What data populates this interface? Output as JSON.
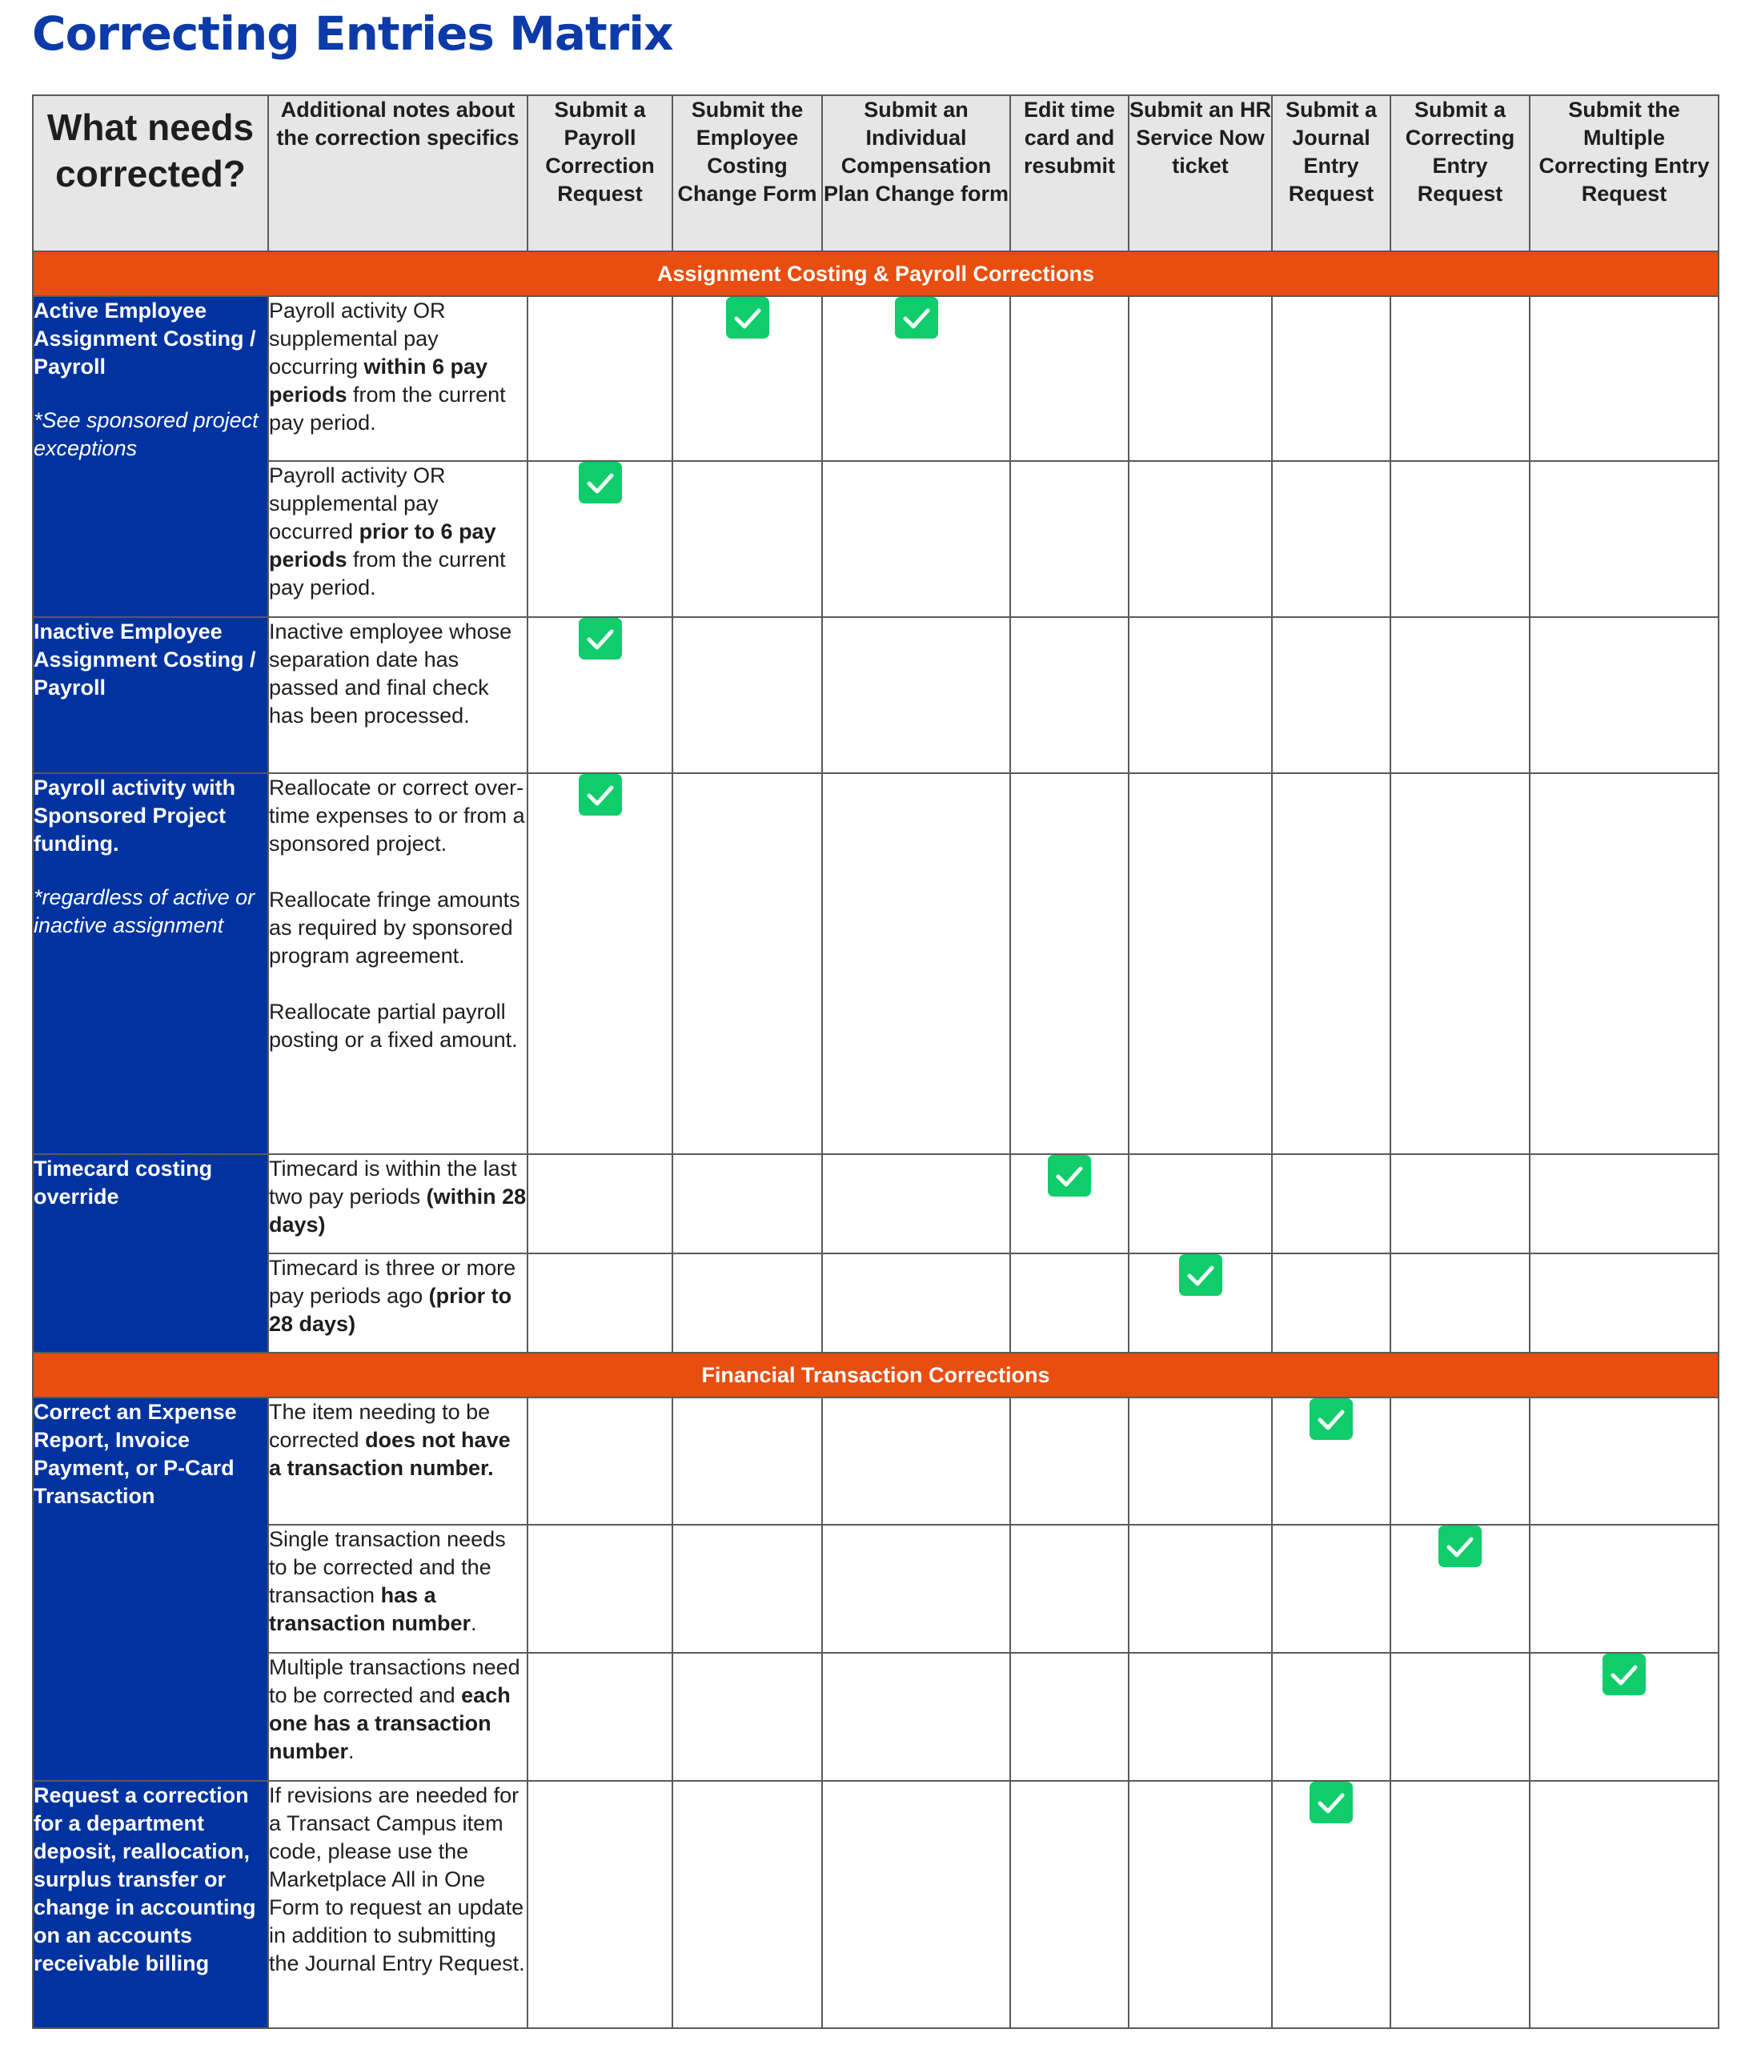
{
  "title": "Correcting Entries Matrix",
  "colors": {
    "title": "#0c3aa8",
    "header_bg": "#e6e6e6",
    "band_bg": "#e84e0f",
    "category_bg": "#0033a0",
    "check_bg": "#10cc6a"
  },
  "header": {
    "question": "What needs corrected?",
    "notes": "Additional notes about the correction specifics",
    "actions": [
      "Submit a Payroll Correction Request",
      "Submit the Employee Costing Change Form",
      "Submit an Individual Compensation Plan Change form",
      "Edit time card and resubmit",
      "Submit an HR Service Now ticket",
      "Submit a Journal Entry Request",
      "Submit a Correcting Entry Request",
      "Submit the Multiple Correcting Entry Request"
    ]
  },
  "sections": [
    {
      "label": "Assignment Costing & Payroll Corrections",
      "groups": [
        {
          "category": "Active Employee Assignment Costing / Payroll",
          "category_note": "*See sponsored project exceptions",
          "rows": [
            {
              "notes": [
                [
                  [
                    "Payroll activity OR supplemental pay occurring ",
                    false
                  ],
                  [
                    "within 6 pay periods",
                    true
                  ],
                  [
                    " from the current pay period.",
                    false
                  ]
                ]
              ],
              "checks": [
                false,
                true,
                true,
                false,
                false,
                false,
                false,
                false
              ]
            },
            {
              "notes": [
                [
                  [
                    "Payroll activity OR supplemental pay occurred ",
                    false
                  ],
                  [
                    "prior to 6 pay periods",
                    true
                  ],
                  [
                    " from the current pay period.",
                    false
                  ]
                ]
              ],
              "checks": [
                true,
                false,
                false,
                false,
                false,
                false,
                false,
                false
              ]
            }
          ]
        },
        {
          "category": "Inactive Employee Assignment Costing / Payroll",
          "category_note": "",
          "rows": [
            {
              "notes": [
                [
                  [
                    "Inactive employee whose separation date has passed and final check has been processed.",
                    false
                  ]
                ]
              ],
              "checks": [
                true,
                false,
                false,
                false,
                false,
                false,
                false,
                false
              ]
            }
          ]
        },
        {
          "category": "Payroll activity with Sponsored Project funding.",
          "category_note": "*regardless of active or inactive assignment",
          "rows": [
            {
              "notes": [
                [
                  [
                    "Reallocate or correct over-time expenses to or from a sponsored project.",
                    false
                  ]
                ],
                [
                  [
                    "Reallocate fringe amounts as required by sponsored program agreement.",
                    false
                  ]
                ],
                [
                  [
                    "Reallocate partial payroll posting or a fixed amount.",
                    false
                  ]
                ]
              ],
              "checks": [
                true,
                false,
                false,
                false,
                false,
                false,
                false,
                false
              ]
            }
          ]
        },
        {
          "category": "Timecard costing override",
          "category_note": "",
          "rows": [
            {
              "notes": [
                [
                  [
                    "Timecard is within the last two pay periods ",
                    false
                  ],
                  [
                    "(within 28 days)",
                    true
                  ]
                ]
              ],
              "checks": [
                false,
                false,
                false,
                true,
                false,
                false,
                false,
                false
              ]
            },
            {
              "notes": [
                [
                  [
                    "Timecard is three or more pay periods ago ",
                    false
                  ],
                  [
                    "(prior to 28 days)",
                    true
                  ]
                ]
              ],
              "checks": [
                false,
                false,
                false,
                false,
                true,
                false,
                false,
                false
              ]
            }
          ]
        }
      ]
    },
    {
      "label": "Financial Transaction Corrections",
      "groups": [
        {
          "category": "Correct an Expense Report, Invoice Payment, or P-Card Transaction",
          "category_note": "",
          "rows": [
            {
              "notes": [
                [
                  [
                    "The item needing to be corrected ",
                    false
                  ],
                  [
                    "does not have a transaction number.",
                    true
                  ]
                ]
              ],
              "checks": [
                false,
                false,
                false,
                false,
                false,
                true,
                false,
                false
              ]
            },
            {
              "notes": [
                [
                  [
                    "Single transaction needs to be corrected and the transaction ",
                    false
                  ],
                  [
                    "has a transaction number",
                    true
                  ],
                  [
                    ".",
                    false
                  ]
                ]
              ],
              "checks": [
                false,
                false,
                false,
                false,
                false,
                false,
                true,
                false
              ]
            },
            {
              "notes": [
                [
                  [
                    "Multiple transactions need to be corrected and ",
                    false
                  ],
                  [
                    "each one  has a transaction number",
                    true
                  ],
                  [
                    ".",
                    false
                  ]
                ]
              ],
              "checks": [
                false,
                false,
                false,
                false,
                false,
                false,
                false,
                true
              ]
            }
          ]
        },
        {
          "category": "Request a correction for a department deposit, reallocation, surplus transfer or change in accounting on an accounts receivable billing",
          "category_note": "",
          "top_aligned": true,
          "rows": [
            {
              "notes": [
                [
                  [
                    "If revisions are needed for a Transact Campus item code, please use the Marketplace All in One Form to request an update in addition to submitting the Journal Entry Request.",
                    false
                  ]
                ]
              ],
              "checks": [
                false,
                false,
                false,
                false,
                false,
                true,
                false,
                false
              ]
            }
          ]
        }
      ]
    }
  ]
}
